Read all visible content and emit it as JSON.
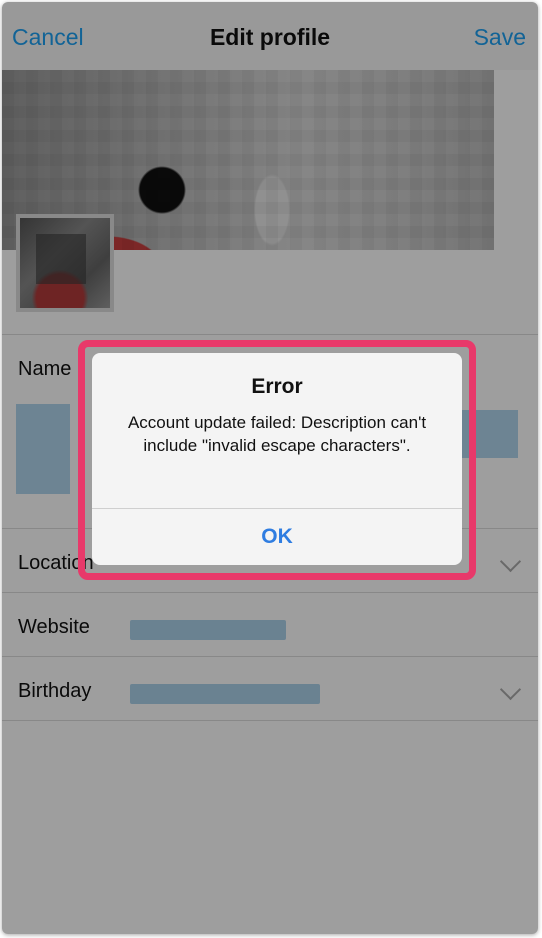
{
  "nav": {
    "cancel_label": "Cancel",
    "title": "Edit profile",
    "save_label": "Save"
  },
  "fields": {
    "name_label": "Name",
    "location_label": "Location",
    "website_label": "Website",
    "birthday_label": "Birthday"
  },
  "alert": {
    "title": "Error",
    "message": "Account update failed: Description can't include \"invalid escape characters\".",
    "ok_label": "OK"
  },
  "colors": {
    "accent": "#1da1f2",
    "alert_highlight": "#e8396a",
    "ok_button": "#2f7de1"
  },
  "icons": {
    "location_chevron": "chevron-down-icon",
    "birthday_chevron": "chevron-down-icon"
  }
}
